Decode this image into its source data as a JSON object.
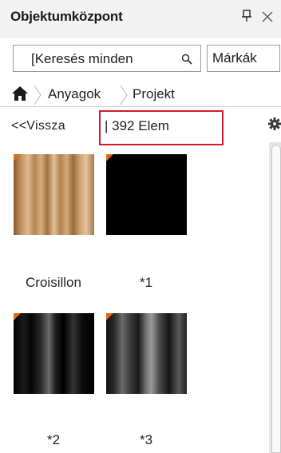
{
  "panel": {
    "title": "Objektumközpont"
  },
  "search": {
    "value": "[Keresés minden",
    "brands_label": "Márkák"
  },
  "breadcrumb": {
    "items": [
      "Anyagok",
      "Projekt"
    ]
  },
  "toolbar": {
    "back_label": "<<Vissza",
    "item_count": "| 392 Elem"
  },
  "items": [
    {
      "caption": "Croisillon"
    },
    {
      "caption": "*1"
    },
    {
      "caption": "*2"
    },
    {
      "caption": "*3"
    }
  ],
  "colors": {
    "highlight_box": "#d11b2a",
    "badge_corner": "#e06a12"
  }
}
